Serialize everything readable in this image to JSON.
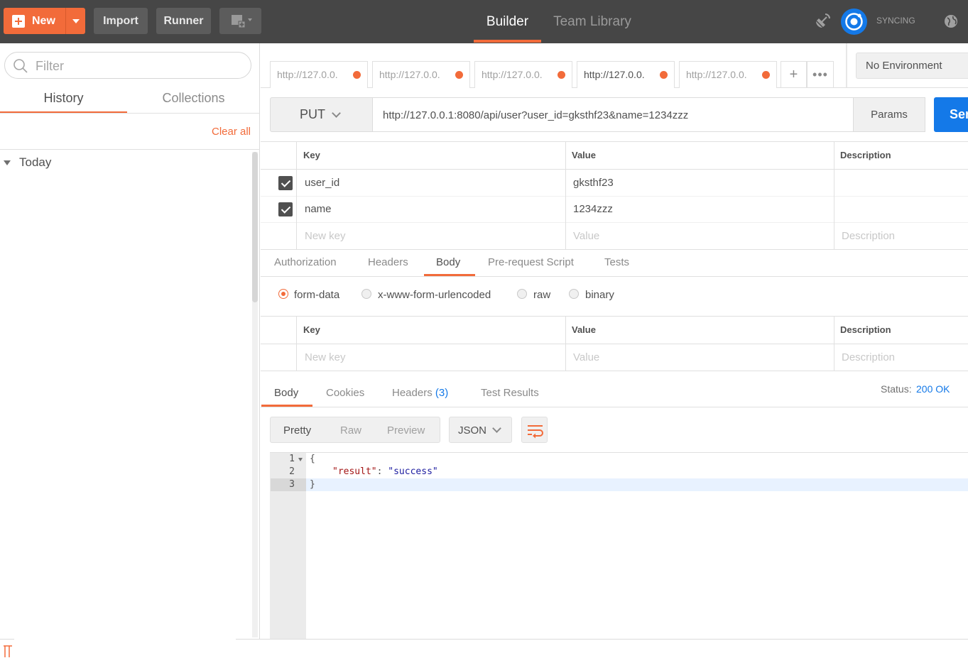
{
  "topbar": {
    "new_label": "New",
    "import_label": "Import",
    "runner_label": "Runner",
    "tabs": [
      "Builder",
      "Team Library"
    ],
    "sync_label": "SYNCING"
  },
  "sidebar": {
    "filter_placeholder": "Filter",
    "tabs": [
      "History",
      "Collections"
    ],
    "clear_all": "Clear all",
    "group_today": "Today"
  },
  "request_tabs": [
    "http://127.0.0.",
    "http://127.0.0.",
    "http://127.0.0.",
    "http://127.0.0.",
    "http://127.0.0."
  ],
  "request_tab_add": "+",
  "request_tab_more": "•••",
  "environment": "No Environment",
  "request": {
    "method": "PUT",
    "url": "http://127.0.0.1:8080/api/user?user_id=gksthf23&name=1234zzz",
    "params_label": "Params",
    "send_label": "Send"
  },
  "params_table": {
    "headers": [
      "Key",
      "Value",
      "Description"
    ],
    "rows": [
      {
        "key": "user_id",
        "value": "gksthf23"
      },
      {
        "key": "name",
        "value": "1234zzz"
      }
    ],
    "placeholders": {
      "key": "New key",
      "value": "Value",
      "description": "Description"
    }
  },
  "request_subtabs": [
    "Authorization",
    "Headers",
    "Body",
    "Pre-request Script",
    "Tests"
  ],
  "body_modes": [
    "form-data",
    "x-www-form-urlencoded",
    "raw",
    "binary"
  ],
  "body_table": {
    "headers": [
      "Key",
      "Value",
      "Description"
    ],
    "placeholders": {
      "key": "New key",
      "value": "Value",
      "description": "Description"
    }
  },
  "response": {
    "tabs": {
      "body": "Body",
      "cookies": "Cookies",
      "headers": "Headers",
      "headers_count": "(3)",
      "tests": "Test Results"
    },
    "status_label": "Status:",
    "status_value": "200 OK",
    "formats": [
      "Pretty",
      "Raw",
      "Preview"
    ],
    "language": "JSON",
    "lines": [
      "1",
      "2",
      "3"
    ],
    "code": {
      "open": "{",
      "key": "\"result\"",
      "colon": ": ",
      "value": "\"success\"",
      "close": "}"
    }
  },
  "colors": {
    "accent": "#f26b3a",
    "primary": "#1479e8",
    "topbar": "#464646"
  }
}
